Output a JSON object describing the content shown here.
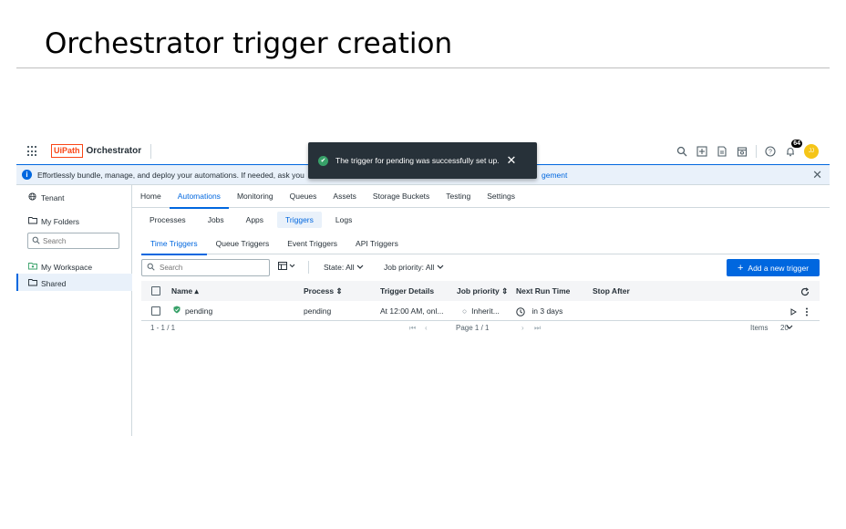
{
  "slide": {
    "title": "Orchestrator trigger creation"
  },
  "header": {
    "logo_mark": "UiPath",
    "product": "Orchestrator",
    "notification_count": "64",
    "avatar_initials": "JJ"
  },
  "toast": {
    "message": "The trigger for pending was successfully set up."
  },
  "banner": {
    "text": "Effortlessly bundle, manage, and deploy your automations. If needed, ask you",
    "link_fragment": "gement"
  },
  "sidebar": {
    "tenant": "Tenant",
    "my_folders": "My Folders",
    "search_placeholder": "Search",
    "items": [
      {
        "label": "My Workspace"
      },
      {
        "label": "Shared"
      }
    ]
  },
  "nav": {
    "main_tabs": [
      "Home",
      "Automations",
      "Monitoring",
      "Queues",
      "Assets",
      "Storage Buckets",
      "Testing",
      "Settings"
    ],
    "active_main": "Automations",
    "sub_tabs": [
      "Processes",
      "Jobs",
      "Apps",
      "Triggers",
      "Logs"
    ],
    "active_sub": "Triggers",
    "trigger_tabs": [
      "Time Triggers",
      "Queue Triggers",
      "Event Triggers",
      "API Triggers"
    ],
    "active_trigger": "Time Triggers"
  },
  "toolbar": {
    "search_placeholder": "Search",
    "state_filter": "State: All",
    "priority_filter": "Job priority: All",
    "add_button": "Add a new trigger"
  },
  "table": {
    "columns": [
      "Name",
      "Process",
      "Trigger Details",
      "Job priority",
      "Next Run Time",
      "Stop After"
    ],
    "rows": [
      {
        "name": "pending",
        "process": "pending",
        "trigger_details": "At 12:00 AM, onl...",
        "job_priority": "Inherit...",
        "next_run": "in 3 days",
        "stop_after": ""
      }
    ]
  },
  "pagination": {
    "range": "1 - 1 / 1",
    "page": "Page 1 / 1",
    "items_label": "Items",
    "page_size": "20"
  },
  "colors": {
    "accent": "#0067df",
    "brand": "#fa4616",
    "success": "#38a169",
    "toast_bg": "#273139"
  }
}
